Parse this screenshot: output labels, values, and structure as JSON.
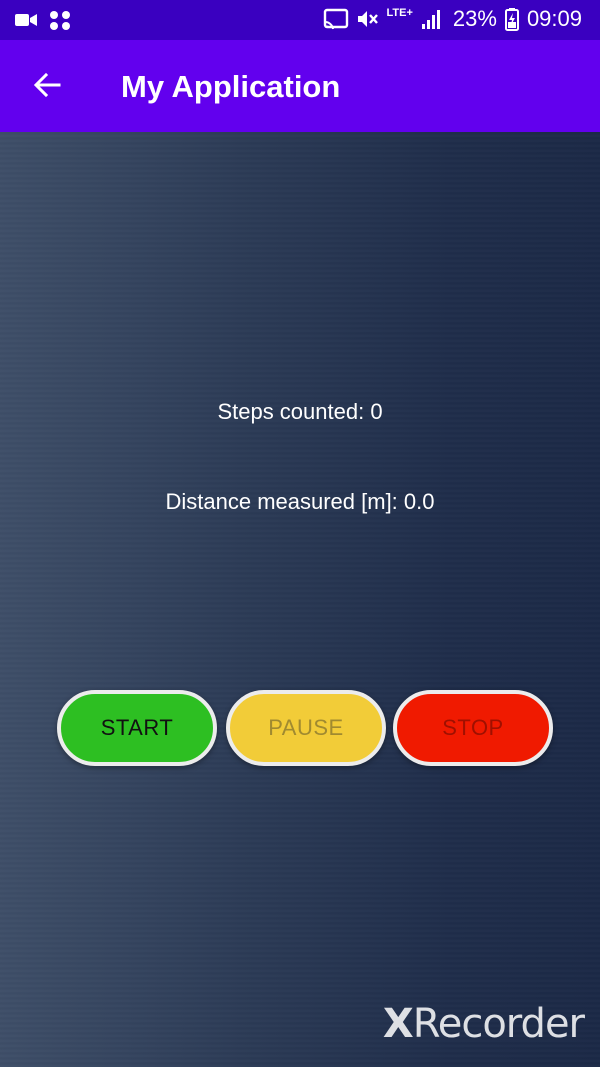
{
  "status_bar": {
    "battery": "23%",
    "time": "09:09",
    "network": "LTE+",
    "icons": [
      "video-recorder-icon",
      "app-grid-icon",
      "cast-icon",
      "mute-icon",
      "signal-icon",
      "battery-icon"
    ]
  },
  "app_bar": {
    "title": "My Application",
    "back_icon": "arrow-left-icon",
    "color": "#6200ee"
  },
  "main": {
    "steps_text": "Steps counted: 0",
    "distance_text": "Distance measured [m]: 0.0"
  },
  "buttons": {
    "start": {
      "label": "START",
      "color": "#2dbf22"
    },
    "pause": {
      "label": "PAUSE",
      "color": "#f2cc38"
    },
    "stop": {
      "label": "STOP",
      "color": "#f01a00"
    }
  },
  "watermark": {
    "x": "X",
    "rest": "Recorder"
  }
}
